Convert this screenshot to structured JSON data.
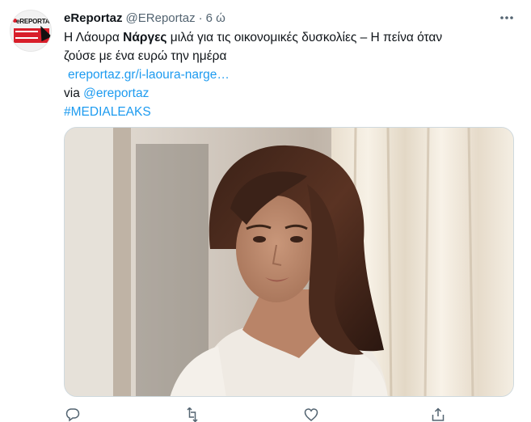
{
  "tweet": {
    "author": {
      "name": "eReportaz",
      "handle": "@EReportaz",
      "separator": "·",
      "time": "6 ώ",
      "avatar_text": "eREPORTAZ"
    },
    "text": {
      "line1_pre": "Η Λάουρα ",
      "line1_bold": "Νάργες",
      "line1_post": " μιλά για τις οικονομικές δυσκολίες – Η πείνα όταν",
      "line2": "ζούσε με ένα ευρώ την ημέρα",
      "url": "ereportaz.gr/i-laoura-narge…",
      "via_prefix": "via ",
      "via_handle": "@ereportaz",
      "hashtag": "#MEDIALEAKS"
    },
    "icons": {
      "more": "more-horizontal-icon",
      "reply": "reply-icon",
      "retweet": "retweet-icon",
      "like": "heart-icon",
      "share": "share-icon"
    },
    "colors": {
      "link": "#1d9bf0",
      "text": "#0f1419",
      "secondary": "#536471",
      "avatar_red": "#d81e2a"
    }
  }
}
